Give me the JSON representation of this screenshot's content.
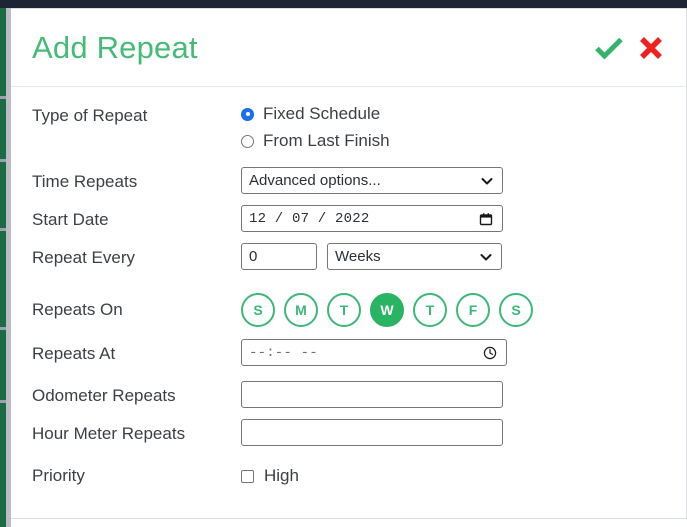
{
  "modal": {
    "title": "Add Repeat",
    "confirm_label": "confirm",
    "cancel_label": "cancel"
  },
  "form": {
    "type_of_repeat": {
      "label": "Type of Repeat",
      "options": [
        {
          "label": "Fixed Schedule",
          "selected": true
        },
        {
          "label": "From Last Finish",
          "selected": false
        }
      ]
    },
    "time_repeats": {
      "label": "Time Repeats",
      "value": "Advanced options..."
    },
    "start_date": {
      "label": "Start Date",
      "value": "12 / 07 / 2022"
    },
    "repeat_every": {
      "label": "Repeat Every",
      "count_value": "0",
      "unit_value": "Weeks"
    },
    "repeats_on": {
      "label": "Repeats On",
      "days": [
        {
          "letter": "S",
          "name": "sunday",
          "selected": false
        },
        {
          "letter": "M",
          "name": "monday",
          "selected": false
        },
        {
          "letter": "T",
          "name": "tuesday",
          "selected": false
        },
        {
          "letter": "W",
          "name": "wednesday",
          "selected": true
        },
        {
          "letter": "T",
          "name": "thursday",
          "selected": false
        },
        {
          "letter": "F",
          "name": "friday",
          "selected": false
        },
        {
          "letter": "S",
          "name": "saturday",
          "selected": false
        }
      ]
    },
    "repeats_at": {
      "label": "Repeats At",
      "value": "--:--  --"
    },
    "odometer_repeats": {
      "label": "Odometer Repeats",
      "value": ""
    },
    "hour_meter_repeats": {
      "label": "Hour Meter Repeats",
      "value": ""
    },
    "priority": {
      "label": "Priority",
      "checkbox_label": "High",
      "checked": false
    }
  },
  "colors": {
    "brand_green": "#44bb77",
    "day_green": "#3cb878",
    "day_selected": "#28b463",
    "confirm_green": "#34b36a",
    "cancel_red": "#ef2020",
    "highlight_yellow": "#ffd400",
    "radio_blue": "#1673e8"
  }
}
